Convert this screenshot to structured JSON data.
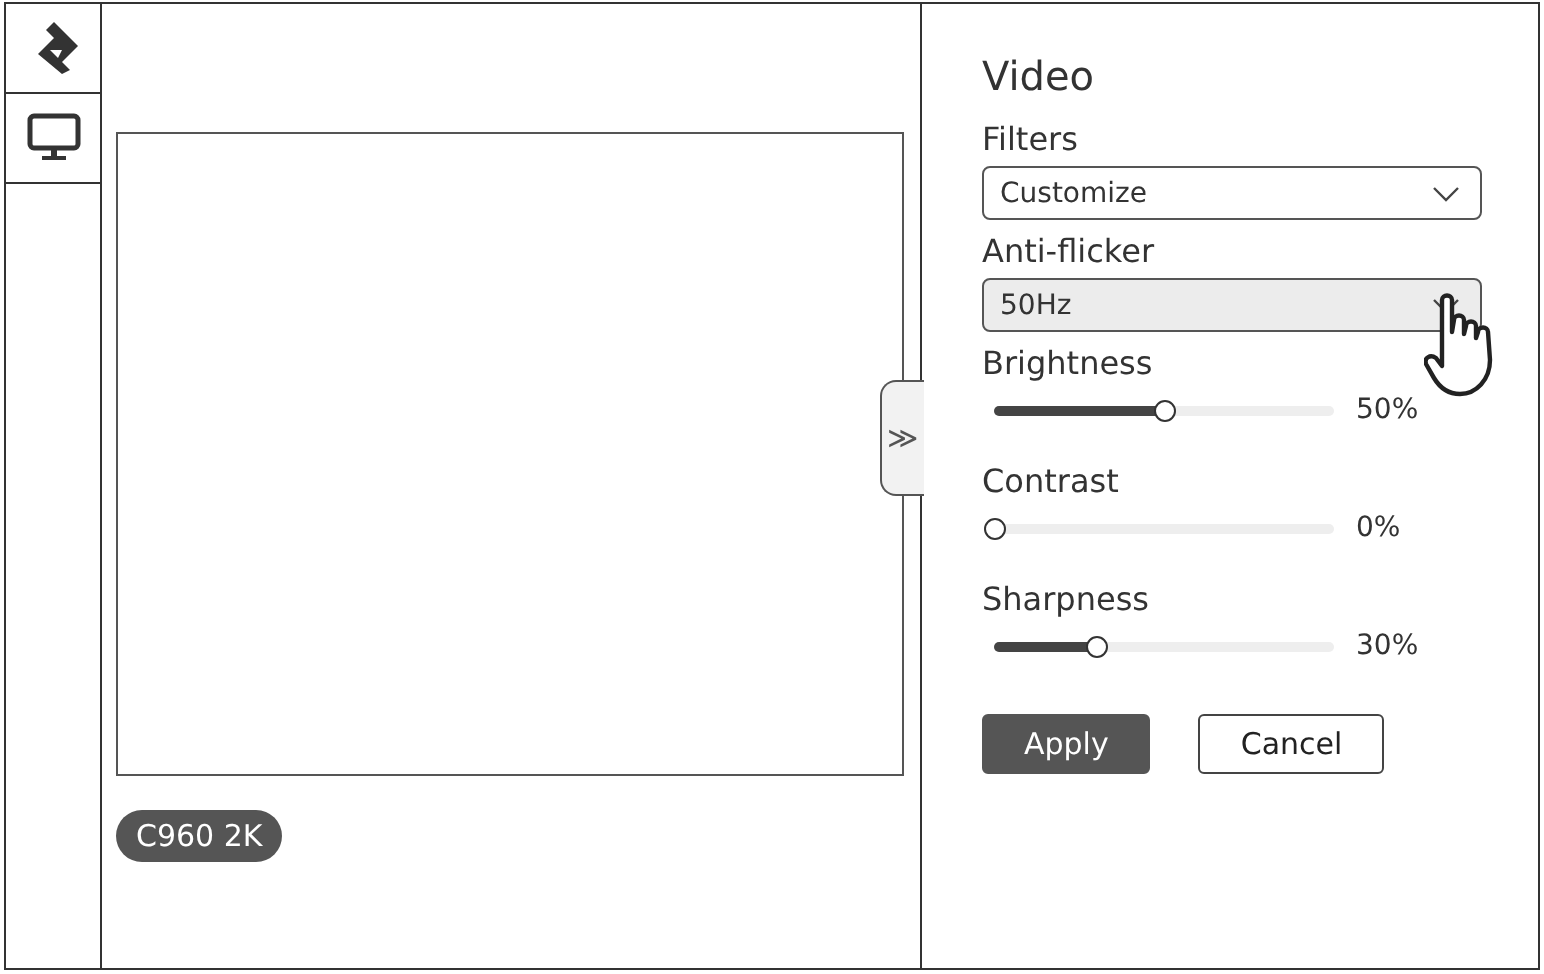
{
  "sidebar": {
    "items": [
      {
        "kind": "logo"
      },
      {
        "kind": "monitor"
      }
    ]
  },
  "preview": {
    "device_label": "C960 2K",
    "collapse_toggle": "≫"
  },
  "panel": {
    "title": "Video",
    "dropdowns": [
      {
        "label": "Filters",
        "value": "Customize",
        "hovered": false
      },
      {
        "label": "Anti-flicker",
        "value": "50Hz",
        "hovered": true
      }
    ],
    "sliders": [
      {
        "label": "Brightness",
        "level": 0.5,
        "reading": "50%"
      },
      {
        "label": "Contrast",
        "level": 0,
        "reading": "0%"
      },
      {
        "label": "Sharpness",
        "level": 0.3,
        "reading": "30%"
      }
    ],
    "buttons": [
      {
        "label": "Apply",
        "kind": "primary"
      },
      {
        "label": "Cancel",
        "kind": "secondary"
      }
    ]
  }
}
